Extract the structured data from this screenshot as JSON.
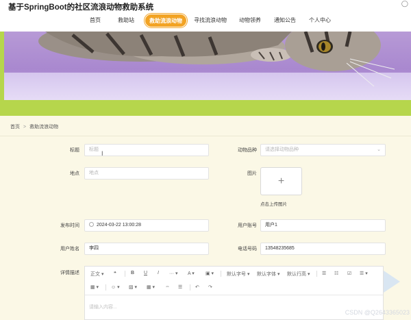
{
  "header": {
    "site_title": "基于SpringBoot的社区流浪动物救助系统",
    "nav": [
      "首页",
      "救助站",
      "救助流浪动物",
      "寻找流浪动物",
      "动物领养",
      "通知公告",
      "个人中心"
    ],
    "active_nav": "救助流浪动物"
  },
  "breadcrumb": {
    "home": "首页",
    "separator": ">",
    "current": "救助流浪动物"
  },
  "form": {
    "title_label": "标题",
    "title_placeholder": "标题",
    "breed_label": "动物品种",
    "breed_placeholder": "请选择动物品种",
    "location_label": "地点",
    "location_placeholder": "地点",
    "image_label": "图片",
    "upload_plus": "+",
    "upload_tip": "点击上传图片",
    "publish_time_label": "发布时间",
    "publish_time_value": "2024-03-22 13:00:28",
    "account_label": "用户账号",
    "account_value": "用户1",
    "name_label": "用户姓名",
    "name_value": "李四",
    "phone_label": "电话号码",
    "phone_value": "13548235685",
    "details_label": "详情描述"
  },
  "editor": {
    "toolbar_row1": [
      "正文 ▾",
      "❝",
      "B",
      "U",
      "I",
      "··· ▾",
      "A ▾",
      "▣ ▾",
      "默认字号 ▾",
      "默认字体 ▾",
      "默认行高 ▾",
      "☰",
      "☷",
      "☑",
      "☰ ▾"
    ],
    "toolbar_row2": [
      "▦ ▾",
      "☺ ▾",
      "▨ ▾",
      "▦ ▾",
      "⇔",
      "☰",
      "↶",
      "↷"
    ],
    "placeholder": "请输入内容..."
  },
  "watermark": "CSDN @Q2643365023",
  "colors": {
    "accent": "#f2a324",
    "banner_green": "#b6d64c",
    "page_bg": "#fbf8e6"
  }
}
